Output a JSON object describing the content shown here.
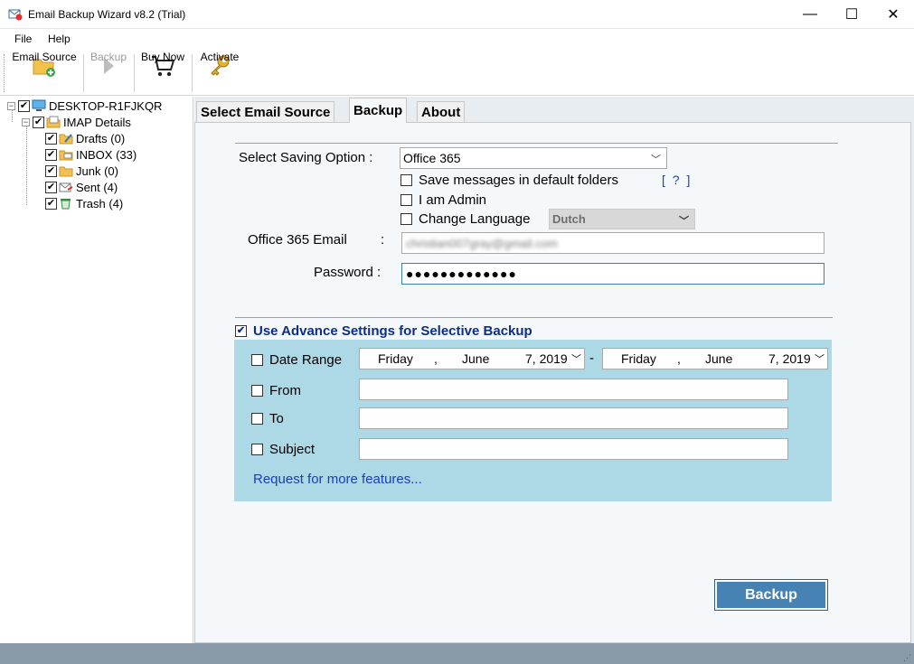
{
  "window": {
    "title": "Email Backup Wizard v8.2 (Trial)",
    "min_glyph": "—",
    "max_glyph": "☐",
    "close_glyph": "✕"
  },
  "menu": [
    "File",
    "Help"
  ],
  "toolbar": {
    "email_source": "Email Source",
    "backup": "Backup",
    "buy_now": "Buy Now",
    "activate": "Activate"
  },
  "tree": {
    "root": "DESKTOP-R1FJKQR",
    "account": "IMAP Details",
    "folders": [
      {
        "label": "Drafts (0)",
        "icon": "drafts-icon"
      },
      {
        "label": "INBOX (33)",
        "icon": "inbox-icon"
      },
      {
        "label": "Junk (0)",
        "icon": "junk-icon"
      },
      {
        "label": "Sent (4)",
        "icon": "sent-icon"
      },
      {
        "label": "Trash (4)",
        "icon": "trash-icon"
      }
    ]
  },
  "tabs": [
    "Select Email Source",
    "Backup",
    "About"
  ],
  "active_tab": "Backup",
  "form": {
    "saving_option_label": "Select Saving Option :",
    "saving_option_value": "Office 365",
    "save_default_folders": "Save messages in default folders",
    "help_link": "[ ? ]",
    "i_am_admin": "I am Admin",
    "change_language": "Change Language",
    "language_value": "Dutch",
    "email_label": "Office 365 Email",
    "email_colon": ":",
    "email_value": "christian007gray@gmail.com",
    "password_label": "Password :",
    "password_value": "●●●●●●●●●●●●●"
  },
  "advanced": {
    "title": "Use Advance Settings for Selective Backup",
    "checked": true,
    "date_range": "Date Range",
    "date_from": {
      "day": "Friday",
      "month": "June",
      "date": "7, 2019"
    },
    "date_sep": "-",
    "date_to": {
      "day": "Friday",
      "month": "June",
      "date": "7, 2019"
    },
    "from": "From",
    "to": "To",
    "subject": "Subject",
    "request_link": "Request for more features..."
  },
  "backup_button": "Backup",
  "colors": {
    "accent": "#4682b4",
    "advanced_bg": "#add8e6",
    "link": "#1a3fb5",
    "status_bar": "#8a9aa8"
  }
}
